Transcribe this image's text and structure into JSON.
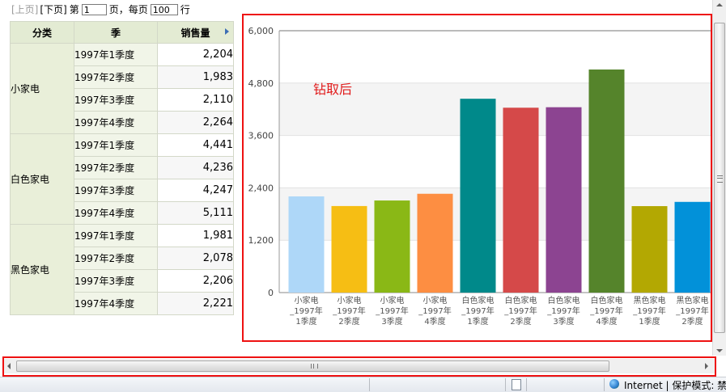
{
  "pager": {
    "prev": "[上页]",
    "next": "[下页]",
    "page_prefix": "第",
    "page_value": "1",
    "page_suffix": "页，每页",
    "rows_value": "100",
    "rows_suffix": "行"
  },
  "table": {
    "headers": [
      "分类",
      "季",
      "销售量"
    ],
    "groups": [
      {
        "category": "小家电",
        "rows": [
          {
            "quarter": "1997年1季度",
            "value": "2,204"
          },
          {
            "quarter": "1997年2季度",
            "value": "1,983"
          },
          {
            "quarter": "1997年3季度",
            "value": "2,110"
          },
          {
            "quarter": "1997年4季度",
            "value": "2,264"
          }
        ]
      },
      {
        "category": "白色家电",
        "rows": [
          {
            "quarter": "1997年1季度",
            "value": "4,441"
          },
          {
            "quarter": "1997年2季度",
            "value": "4,236"
          },
          {
            "quarter": "1997年3季度",
            "value": "4,247"
          },
          {
            "quarter": "1997年4季度",
            "value": "5,111"
          }
        ]
      },
      {
        "category": "黑色家电",
        "rows": [
          {
            "quarter": "1997年1季度",
            "value": "1,981"
          },
          {
            "quarter": "1997年2季度",
            "value": "2,078"
          },
          {
            "quarter": "1997年3季度",
            "value": "2,206"
          },
          {
            "quarter": "1997年4季度",
            "value": "2,221"
          }
        ]
      }
    ]
  },
  "chart_data": {
    "type": "bar",
    "annotation": "钻取后",
    "annotation_color": "#e11b1b",
    "ylim": [
      0,
      6000
    ],
    "yticks": [
      0,
      1200,
      2400,
      3600,
      4800,
      6000
    ],
    "ytick_labels": [
      "0",
      "1,200",
      "2,400",
      "3,600",
      "4,800",
      "6,000"
    ],
    "categories": [
      [
        "小家电",
        "_1997年",
        "1季度"
      ],
      [
        "小家电",
        "_1997年",
        "2季度"
      ],
      [
        "小家电",
        "_1997年",
        "3季度"
      ],
      [
        "小家电",
        "_1997年",
        "4季度"
      ],
      [
        "白色家电",
        "_1997年",
        "1季度"
      ],
      [
        "白色家电",
        "_1997年",
        "2季度"
      ],
      [
        "白色家电",
        "_1997年",
        "3季度"
      ],
      [
        "白色家电",
        "_1997年",
        "4季度"
      ],
      [
        "黑色家电",
        "_1997年",
        "1季度"
      ],
      [
        "黑色家电",
        "_1997年",
        "2季度"
      ]
    ],
    "values": [
      2204,
      1983,
      2110,
      2264,
      4441,
      4236,
      4247,
      5111,
      1981,
      2078
    ],
    "colors": [
      "#aed7f8",
      "#f6be14",
      "#8ab816",
      "#fd8e42",
      "#00898a",
      "#d54949",
      "#8c4491",
      "#55842b",
      "#b3a802",
      "#0291d9"
    ]
  },
  "statusbar": {
    "zone_text": "Internet | 保护模式: 禁用"
  }
}
